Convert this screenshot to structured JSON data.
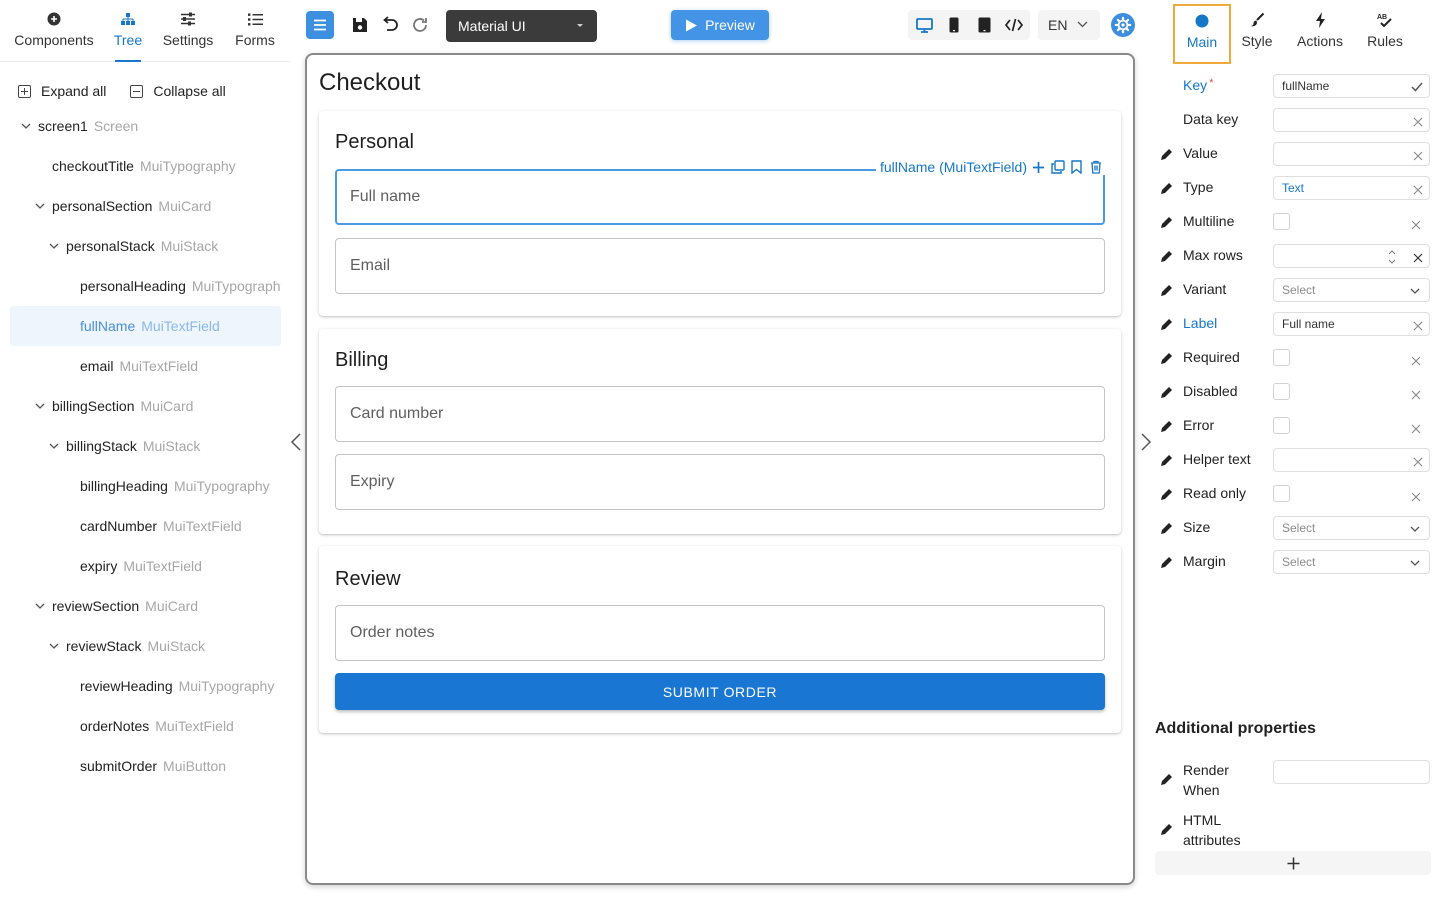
{
  "left_tabs": [
    {
      "label": "Components",
      "icon": "components-icon"
    },
    {
      "label": "Tree",
      "icon": "tree-icon"
    },
    {
      "label": "Settings",
      "icon": "settings-icon"
    },
    {
      "label": "Forms",
      "icon": "forms-icon"
    }
  ],
  "active_left_tab": "Tree",
  "tree_actions": {
    "expand_all": "Expand all",
    "collapse_all": "Collapse all"
  },
  "tree": [
    {
      "name": "screen1",
      "type": "Screen",
      "level": 0,
      "expandable": true
    },
    {
      "name": "checkoutTitle",
      "type": "MuiTypography",
      "level": 1,
      "expandable": false
    },
    {
      "name": "personalSection",
      "type": "MuiCard",
      "level": 1,
      "expandable": true
    },
    {
      "name": "personalStack",
      "type": "MuiStack",
      "level": 2,
      "expandable": true
    },
    {
      "name": "personalHeading",
      "type": "MuiTypography",
      "level": 3,
      "expandable": false
    },
    {
      "name": "fullName",
      "type": "MuiTextField",
      "level": 3,
      "expandable": false,
      "selected": true
    },
    {
      "name": "email",
      "type": "MuiTextField",
      "level": 3,
      "expandable": false
    },
    {
      "name": "billingSection",
      "type": "MuiCard",
      "level": 1,
      "expandable": true
    },
    {
      "name": "billingStack",
      "type": "MuiStack",
      "level": 2,
      "expandable": true
    },
    {
      "name": "billingHeading",
      "type": "MuiTypography",
      "level": 3,
      "expandable": false
    },
    {
      "name": "cardNumber",
      "type": "MuiTextField",
      "level": 3,
      "expandable": false
    },
    {
      "name": "expiry",
      "type": "MuiTextField",
      "level": 3,
      "expandable": false
    },
    {
      "name": "reviewSection",
      "type": "MuiCard",
      "level": 1,
      "expandable": true
    },
    {
      "name": "reviewStack",
      "type": "MuiStack",
      "level": 2,
      "expandable": true
    },
    {
      "name": "reviewHeading",
      "type": "MuiTypography",
      "level": 3,
      "expandable": false
    },
    {
      "name": "orderNotes",
      "type": "MuiTextField",
      "level": 3,
      "expandable": false
    },
    {
      "name": "submitOrder",
      "type": "MuiButton",
      "level": 3,
      "expandable": false
    }
  ],
  "toolbar": {
    "library": "Material UI",
    "preview_label": "Preview",
    "language": "EN"
  },
  "canvas": {
    "title": "Checkout",
    "selection_label": "fullName (MuiTextField)",
    "sections": [
      {
        "heading": "Personal",
        "fields": [
          "Full name",
          "Email"
        ]
      },
      {
        "heading": "Billing",
        "fields": [
          "Card number",
          "Expiry"
        ]
      },
      {
        "heading": "Review",
        "fields": [
          "Order notes"
        ],
        "button": "SUBMIT ORDER"
      }
    ]
  },
  "right_tabs": [
    {
      "label": "Main",
      "icon": "main-dot-icon"
    },
    {
      "label": "Style",
      "icon": "brush-icon"
    },
    {
      "label": "Actions",
      "icon": "lightning-icon"
    },
    {
      "label": "Rules",
      "icon": "spellcheck-icon"
    }
  ],
  "active_right_tab": "Main",
  "properties": [
    {
      "label": "Key",
      "kind": "text",
      "value": "fullName",
      "required": true,
      "highlight": true,
      "pen": false,
      "confirm": true
    },
    {
      "label": "Data key",
      "kind": "text",
      "value": "",
      "pen": false
    },
    {
      "label": "Value",
      "kind": "text",
      "value": "",
      "pen": true
    },
    {
      "label": "Type",
      "kind": "text",
      "value": "Text",
      "pen": true,
      "value_blue": true
    },
    {
      "label": "Multiline",
      "kind": "checkbox",
      "pen": true
    },
    {
      "label": "Max rows",
      "kind": "number",
      "value": "",
      "pen": true
    },
    {
      "label": "Variant",
      "kind": "select",
      "value": "Select",
      "pen": true
    },
    {
      "label": "Label",
      "kind": "text",
      "value": "Full name",
      "pen": true,
      "highlight": true
    },
    {
      "label": "Required",
      "kind": "checkbox",
      "pen": true
    },
    {
      "label": "Disabled",
      "kind": "checkbox",
      "pen": true
    },
    {
      "label": "Error",
      "kind": "checkbox",
      "pen": true
    },
    {
      "label": "Helper text",
      "kind": "text",
      "value": "",
      "pen": true
    },
    {
      "label": "Read only",
      "kind": "checkbox",
      "pen": true
    },
    {
      "label": "Size",
      "kind": "select",
      "value": "Select",
      "pen": true
    },
    {
      "label": "Margin",
      "kind": "select",
      "value": "Select",
      "pen": true
    }
  ],
  "additional": {
    "title": "Additional properties",
    "items": [
      {
        "label_lines": [
          "Render",
          "When"
        ],
        "kind": "text"
      },
      {
        "label_lines": [
          "HTML",
          "attributes"
        ],
        "kind": "none"
      }
    ],
    "add_icon": "plus-icon"
  },
  "colors": {
    "accent": "#1677c8",
    "primary_button": "#1976d2",
    "preview": "#4394e6",
    "main_tab_outline": "#f0a93b"
  }
}
